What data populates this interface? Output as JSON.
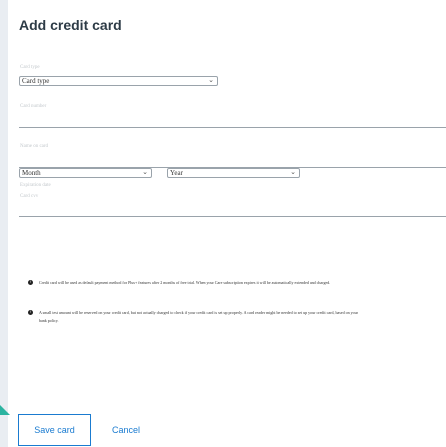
{
  "dialog": {
    "title": "Add credit card"
  },
  "fields": {
    "card_type_label": "Card type",
    "card_type_value": "Card type",
    "card_number_label": "Card number",
    "name_on_card_label": "Name on card",
    "expiration_label": "Expiration date",
    "month_value": "Month",
    "year_value": "Year",
    "cvv_label": "Card cvv"
  },
  "notes": [
    "Credit card will be used as default payment method for Plus+ features after 2 months of free trial. When your Care subscription expires it will be automatically extended and charged.",
    "A small test amount will be reserved on your credit card, but not actually charged to check if your credit card is set up properly. A card reader might be needed to set up your credit card, based on your bank policy."
  ],
  "actions": {
    "save_label": "Save card",
    "cancel_label": "Cancel"
  },
  "colors": {
    "accent": "#1a7bd0",
    "corner_marker": "#2bb3a0"
  }
}
